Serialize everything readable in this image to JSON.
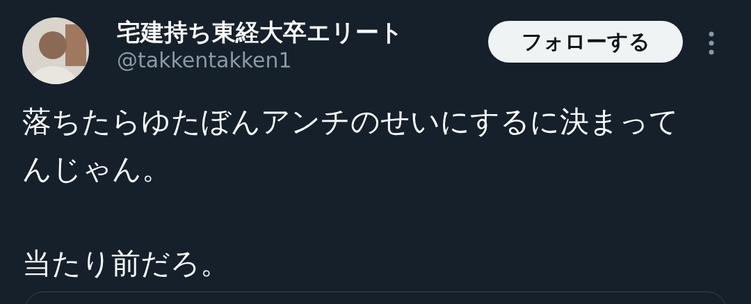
{
  "author": {
    "name": "宅建持ち東経大卒エリート",
    "handle": "@takkentakken1"
  },
  "follow_button": {
    "label": "フォローする"
  },
  "tweet": {
    "paragraphs": [
      "落ちたらゆたぼんアンチのせいにするに決まってんじゃん。",
      "当たり前だろ。"
    ]
  }
}
